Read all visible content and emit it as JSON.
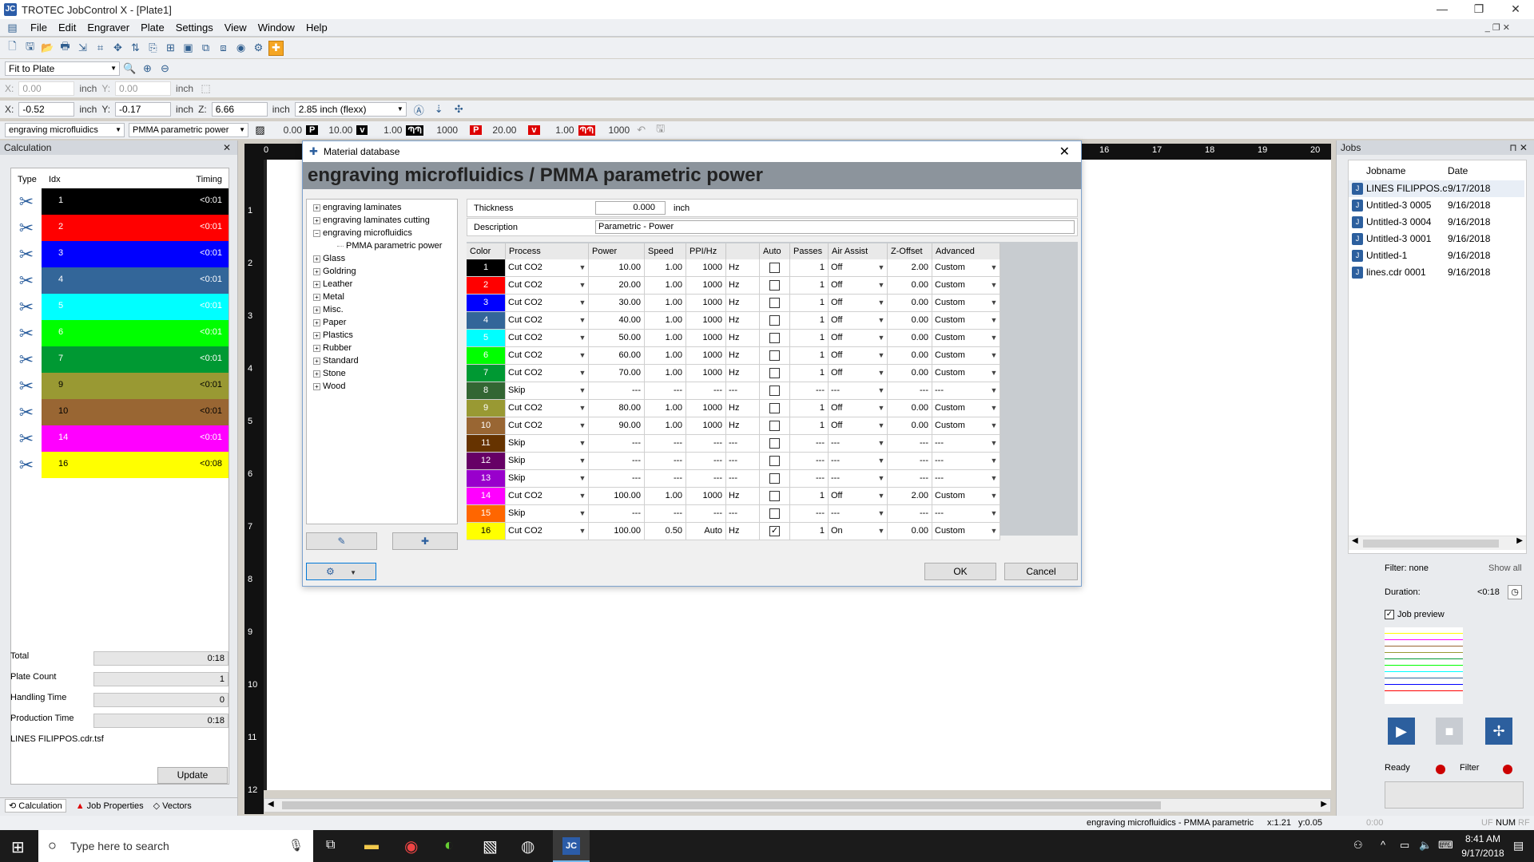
{
  "app": {
    "title": "TROTEC JobControl X - [Plate1]",
    "logo": "JC"
  },
  "menu": [
    "File",
    "Edit",
    "Engraver",
    "Plate",
    "Settings",
    "View",
    "Window",
    "Help"
  ],
  "zoom": {
    "value": "Fit to Plate"
  },
  "pos1": {
    "x_label": "X:",
    "x": "0.00",
    "x_unit": "inch",
    "y_label": "Y:",
    "y": "0.00",
    "y_unit": "inch"
  },
  "pos2": {
    "x_label": "X:",
    "x": "-0.52",
    "x_unit": "inch",
    "y_label": "Y:",
    "y": "-0.17",
    "y_unit": "inch",
    "z_label": "Z:",
    "z": "6.66",
    "z_unit": "inch",
    "lens": "2.85 inch (flexx)"
  },
  "matbar": {
    "material": "engraving microfluidics",
    "template": "PMMA parametric power",
    "v1": "0.00",
    "p_label": "P",
    "p": "10.00",
    "v_label": "v",
    "v": "1.00",
    "hz1": "1000",
    "p2_label": "P",
    "p2": "20.00",
    "v2_label": "v",
    "v2": "1.00",
    "hz2": "1000"
  },
  "calc": {
    "title": "Calculation",
    "col_type": "Type",
    "col_idx": "Idx",
    "col_timing": "Timing",
    "rows": [
      {
        "idx": "1",
        "timing": "<0:01",
        "color": "#000000",
        "text": "#ffffff"
      },
      {
        "idx": "2",
        "timing": "<0:01",
        "color": "#ff0000",
        "text": "#ffffff"
      },
      {
        "idx": "3",
        "timing": "<0:01",
        "color": "#0000ff",
        "text": "#ffffff"
      },
      {
        "idx": "4",
        "timing": "<0:01",
        "color": "#336699",
        "text": "#ffffff"
      },
      {
        "idx": "5",
        "timing": "<0:01",
        "color": "#00ffff",
        "text": "#ffffff"
      },
      {
        "idx": "6",
        "timing": "<0:01",
        "color": "#00ff00",
        "text": "#ffffff"
      },
      {
        "idx": "7",
        "timing": "<0:01",
        "color": "#009933",
        "text": "#ffffff"
      },
      {
        "idx": "9",
        "timing": "<0:01",
        "color": "#999933",
        "text": "#000000"
      },
      {
        "idx": "10",
        "timing": "<0:01",
        "color": "#996633",
        "text": "#000000"
      },
      {
        "idx": "14",
        "timing": "<0:01",
        "color": "#ff00ff",
        "text": "#ffffff"
      },
      {
        "idx": "16",
        "timing": "<0:08",
        "color": "#ffff00",
        "text": "#000000"
      }
    ],
    "total_label": "Total",
    "total": "0:18",
    "plate_label": "Plate Count",
    "plate": "1",
    "handling_label": "Handling Time",
    "handling": "0",
    "production_label": "Production Time",
    "production": "0:18",
    "file": "LINES FILIPPOS.cdr.tsf",
    "update": "Update",
    "tabs": [
      "Calculation",
      "Job Properties",
      "Vectors"
    ]
  },
  "dialog": {
    "title": "Material database",
    "heading": "engraving microfluidics / PMMA parametric power",
    "tree": [
      "engraving laminates",
      "engraving laminates cutting",
      "engraving microfluidics",
      "PMMA parametric power",
      "Glass",
      "Goldring",
      "Leather",
      "Metal",
      "Misc.",
      "Paper",
      "Plastics",
      "Rubber",
      "Standard",
      "Stone",
      "Wood"
    ],
    "thickness_label": "Thickness",
    "thickness": "0.000",
    "thickness_unit": "inch",
    "desc_label": "Description",
    "desc": "Parametric - Power",
    "cols": [
      "Color",
      "Process",
      "Power",
      "Speed",
      "PPI/Hz",
      "",
      "Auto",
      "Passes",
      "Air Assist",
      "Z-Offset",
      "Advanced"
    ],
    "rows": [
      {
        "c": "1",
        "bg": "#000000",
        "fg": "#ffffff",
        "proc": "Cut CO2",
        "power": "10.00",
        "speed": "1.00",
        "ppi": "1000",
        "unit": "Hz",
        "auto": false,
        "passes": "1",
        "air": "Off",
        "z": "2.00",
        "adv": "Custom"
      },
      {
        "c": "2",
        "bg": "#ff0000",
        "fg": "#ffffff",
        "proc": "Cut CO2",
        "power": "20.00",
        "speed": "1.00",
        "ppi": "1000",
        "unit": "Hz",
        "auto": false,
        "passes": "1",
        "air": "Off",
        "z": "0.00",
        "adv": "Custom"
      },
      {
        "c": "3",
        "bg": "#0000ff",
        "fg": "#ffffff",
        "proc": "Cut CO2",
        "power": "30.00",
        "speed": "1.00",
        "ppi": "1000",
        "unit": "Hz",
        "auto": false,
        "passes": "1",
        "air": "Off",
        "z": "0.00",
        "adv": "Custom"
      },
      {
        "c": "4",
        "bg": "#336699",
        "fg": "#ffffff",
        "proc": "Cut CO2",
        "power": "40.00",
        "speed": "1.00",
        "ppi": "1000",
        "unit": "Hz",
        "auto": false,
        "passes": "1",
        "air": "Off",
        "z": "0.00",
        "adv": "Custom"
      },
      {
        "c": "5",
        "bg": "#00ffff",
        "fg": "#ffffff",
        "proc": "Cut CO2",
        "power": "50.00",
        "speed": "1.00",
        "ppi": "1000",
        "unit": "Hz",
        "auto": false,
        "passes": "1",
        "air": "Off",
        "z": "0.00",
        "adv": "Custom"
      },
      {
        "c": "6",
        "bg": "#00ff00",
        "fg": "#ffffff",
        "proc": "Cut CO2",
        "power": "60.00",
        "speed": "1.00",
        "ppi": "1000",
        "unit": "Hz",
        "auto": false,
        "passes": "1",
        "air": "Off",
        "z": "0.00",
        "adv": "Custom"
      },
      {
        "c": "7",
        "bg": "#009933",
        "fg": "#ffffff",
        "proc": "Cut CO2",
        "power": "70.00",
        "speed": "1.00",
        "ppi": "1000",
        "unit": "Hz",
        "auto": false,
        "passes": "1",
        "air": "Off",
        "z": "0.00",
        "adv": "Custom"
      },
      {
        "c": "8",
        "bg": "#336633",
        "fg": "#ffffff",
        "proc": "Skip",
        "power": "---",
        "speed": "---",
        "ppi": "---",
        "unit": "---",
        "auto": false,
        "passes": "---",
        "air": "---",
        "z": "---",
        "adv": "---"
      },
      {
        "c": "9",
        "bg": "#999933",
        "fg": "#ffffff",
        "proc": "Cut CO2",
        "power": "80.00",
        "speed": "1.00",
        "ppi": "1000",
        "unit": "Hz",
        "auto": false,
        "passes": "1",
        "air": "Off",
        "z": "0.00",
        "adv": "Custom"
      },
      {
        "c": "10",
        "bg": "#996633",
        "fg": "#ffffff",
        "proc": "Cut CO2",
        "power": "90.00",
        "speed": "1.00",
        "ppi": "1000",
        "unit": "Hz",
        "auto": false,
        "passes": "1",
        "air": "Off",
        "z": "0.00",
        "adv": "Custom"
      },
      {
        "c": "11",
        "bg": "#663300",
        "fg": "#ffffff",
        "proc": "Skip",
        "power": "---",
        "speed": "---",
        "ppi": "---",
        "unit": "---",
        "auto": false,
        "passes": "---",
        "air": "---",
        "z": "---",
        "adv": "---"
      },
      {
        "c": "12",
        "bg": "#660066",
        "fg": "#ffffff",
        "proc": "Skip",
        "power": "---",
        "speed": "---",
        "ppi": "---",
        "unit": "---",
        "auto": false,
        "passes": "---",
        "air": "---",
        "z": "---",
        "adv": "---"
      },
      {
        "c": "13",
        "bg": "#9900cc",
        "fg": "#ffffff",
        "proc": "Skip",
        "power": "---",
        "speed": "---",
        "ppi": "---",
        "unit": "---",
        "auto": false,
        "passes": "---",
        "air": "---",
        "z": "---",
        "adv": "---"
      },
      {
        "c": "14",
        "bg": "#ff00ff",
        "fg": "#ffffff",
        "proc": "Cut CO2",
        "power": "100.00",
        "speed": "1.00",
        "ppi": "1000",
        "unit": "Hz",
        "auto": false,
        "passes": "1",
        "air": "Off",
        "z": "2.00",
        "adv": "Custom"
      },
      {
        "c": "15",
        "bg": "#ff6600",
        "fg": "#ffffff",
        "proc": "Skip",
        "power": "---",
        "speed": "---",
        "ppi": "---",
        "unit": "---",
        "auto": false,
        "passes": "---",
        "air": "---",
        "z": "---",
        "adv": "---"
      },
      {
        "c": "16",
        "bg": "#ffff00",
        "fg": "#000000",
        "proc": "Cut CO2",
        "power": "100.00",
        "speed": "0.50",
        "ppi": "Auto",
        "unit": "Hz",
        "auto": true,
        "passes": "1",
        "air": "On",
        "z": "0.00",
        "adv": "Custom"
      }
    ],
    "ok": "OK",
    "cancel": "Cancel"
  },
  "ruler": {
    "top": [
      "0",
      "16",
      "17",
      "18",
      "19",
      "20"
    ],
    "left": [
      "1",
      "2",
      "3",
      "4",
      "5",
      "6",
      "7",
      "8",
      "9",
      "10",
      "11",
      "12"
    ]
  },
  "jobs": {
    "title": "Jobs",
    "col_name": "Jobname",
    "col_date": "Date",
    "rows": [
      {
        "name": "LINES FILIPPOS.c",
        "date": "9/17/2018"
      },
      {
        "name": "Untitled-3 0005",
        "date": "9/16/2018"
      },
      {
        "name": "Untitled-3 0004",
        "date": "9/16/2018"
      },
      {
        "name": "Untitled-3 0001",
        "date": "9/16/2018"
      },
      {
        "name": "Untitled-1",
        "date": "9/16/2018"
      },
      {
        "name": "lines.cdr 0001",
        "date": "9/16/2018"
      }
    ],
    "filter": "Filter: none",
    "showall": "Show all",
    "duration_label": "Duration:",
    "duration": "<0:18",
    "preview": "Job preview",
    "ready": "Ready",
    "filter2": "Filter"
  },
  "status": {
    "text": "engraving microfluidics - PMMA parametric",
    "x": "x:1.21",
    "y": "y:0.05",
    "uf": "UF",
    "num": "NUM",
    "rf": "RF",
    "time": "0:00"
  },
  "taskbar": {
    "search": "Type here to search",
    "time": "8:41 AM",
    "date": "9/17/2018"
  }
}
